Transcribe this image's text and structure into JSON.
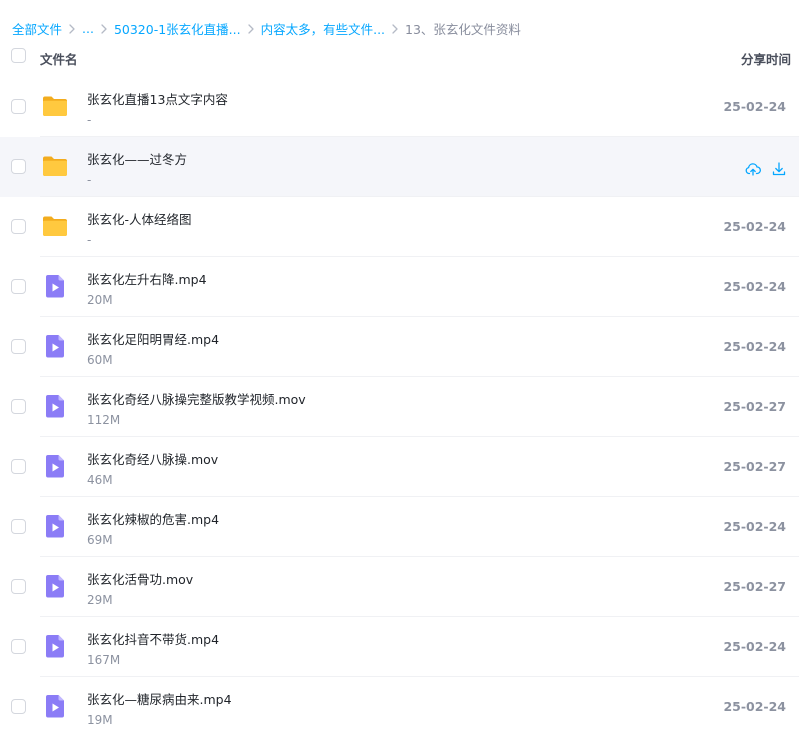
{
  "breadcrumb": [
    {
      "label": "全部文件"
    },
    {
      "label": "..."
    },
    {
      "label": "50320-1张玄化直播..."
    },
    {
      "label": "内容太多，有些文件..."
    },
    {
      "label": "13、张玄化文件资料"
    }
  ],
  "header": {
    "name_label": "文件名",
    "time_label": "分享时间"
  },
  "files": [
    {
      "name": "张玄化直播13点文字内容",
      "size": "-",
      "date": "25-02-24",
      "type": "folder"
    },
    {
      "name": "张玄化——过冬方",
      "size": "-",
      "date": "",
      "type": "folder",
      "hovered": true
    },
    {
      "name": "张玄化-人体经络图",
      "size": "-",
      "date": "25-02-24",
      "type": "folder"
    },
    {
      "name": "张玄化左升右降.mp4",
      "size": "20M",
      "date": "25-02-24",
      "type": "video"
    },
    {
      "name": "张玄化足阳明胃经.mp4",
      "size": "60M",
      "date": "25-02-24",
      "type": "video"
    },
    {
      "name": "张玄化奇经八脉操完整版教学视频.mov",
      "size": "112M",
      "date": "25-02-27",
      "type": "video"
    },
    {
      "name": "张玄化奇经八脉操.mov",
      "size": "46M",
      "date": "25-02-27",
      "type": "video"
    },
    {
      "name": "张玄化辣椒的危害.mp4",
      "size": "69M",
      "date": "25-02-24",
      "type": "video"
    },
    {
      "name": "张玄化活骨功.mov",
      "size": "29M",
      "date": "25-02-27",
      "type": "video"
    },
    {
      "name": "张玄化抖音不带货.mp4",
      "size": "167M",
      "date": "25-02-24",
      "type": "video"
    },
    {
      "name": "张玄化—糖尿病由来.mp4",
      "size": "19M",
      "date": "25-02-24",
      "type": "video"
    }
  ],
  "hover_actions": [
    {
      "icon": "cloud-upload-icon"
    },
    {
      "icon": "download-icon"
    }
  ],
  "colors": {
    "accent": "#06a7ff",
    "folder": "#ffc93f",
    "video": "#8b7cf6"
  }
}
